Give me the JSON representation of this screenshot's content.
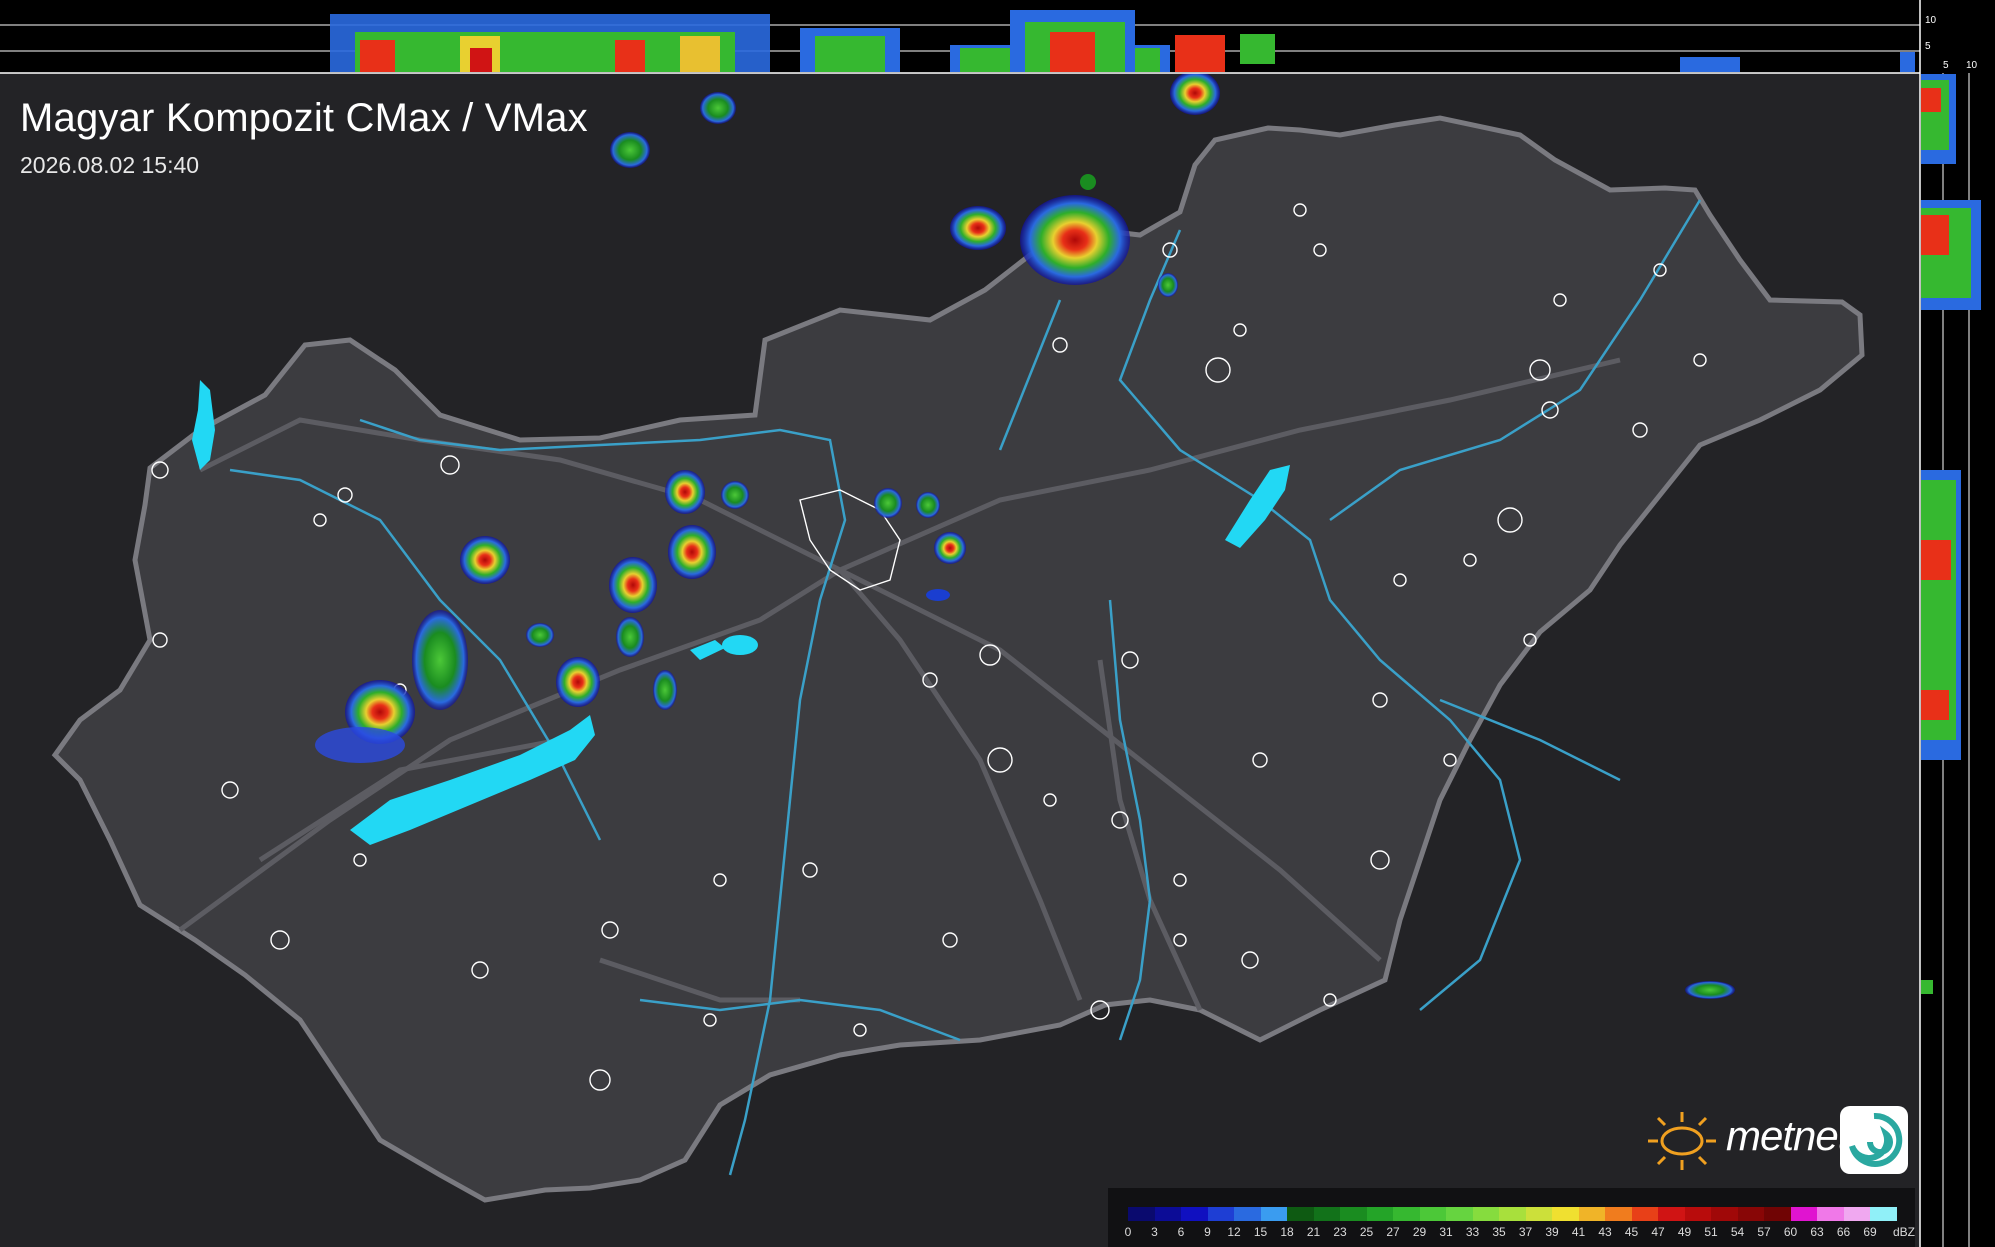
{
  "header": {
    "title": "Magyar Kompozit CMax / VMax",
    "timestamp": "2026.08.02 15:40"
  },
  "logo": {
    "text": "metnet"
  },
  "side_scale": {
    "top_labels": [
      "10",
      "5"
    ],
    "right_labels": [
      "5",
      "10"
    ]
  },
  "legend": {
    "unit": "dBZ",
    "ticks": [
      "0",
      "3",
      "6",
      "9",
      "12",
      "15",
      "18",
      "21",
      "23",
      "25",
      "27",
      "29",
      "31",
      "33",
      "35",
      "37",
      "39",
      "41",
      "43",
      "45",
      "47",
      "49",
      "51",
      "54",
      "57",
      "60",
      "63",
      "66",
      "69"
    ],
    "colors": [
      "#0a0a6e",
      "#0c0c96",
      "#1010c0",
      "#1e3ed4",
      "#2a6ae0",
      "#3a9cf0",
      "#0e5a12",
      "#12721a",
      "#1a8c20",
      "#24a428",
      "#36b830",
      "#4cc838",
      "#66d440",
      "#86dc3e",
      "#a8e03c",
      "#cce03a",
      "#f0e030",
      "#f0b428",
      "#f07c1e",
      "#e84018",
      "#d01414",
      "#b80c0c",
      "#a00808",
      "#880606",
      "#700404",
      "#e014d0",
      "#f078e8",
      "#f0a8f0",
      "#90f0f8"
    ]
  },
  "colors": {
    "background": "#232326",
    "country_border": "#7a7a80",
    "rivers": "#3aa0c8",
    "lakes": "#22d8f4",
    "roads": "#5c5c62",
    "settlements": "#ffffff"
  }
}
